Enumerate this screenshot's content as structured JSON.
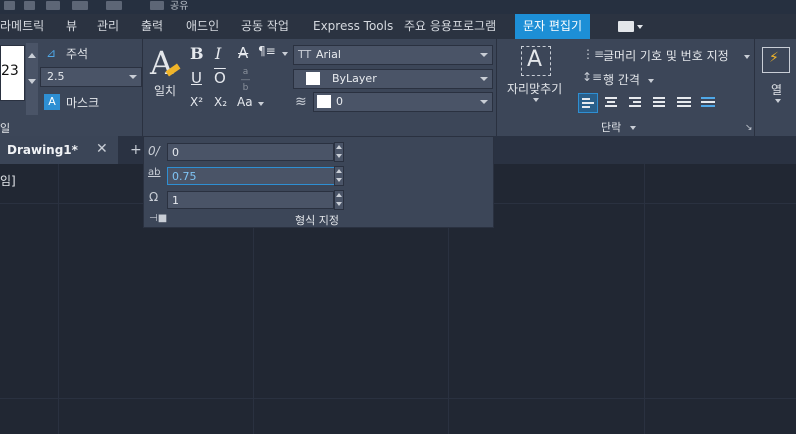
{
  "quick_access": {
    "title_fragment": "공유"
  },
  "ribbon_tabs": [
    {
      "label": "라메트릭"
    },
    {
      "label": "뷰"
    },
    {
      "label": "관리"
    },
    {
      "label": "출력"
    },
    {
      "label": "애드인"
    },
    {
      "label": "공동 작업"
    },
    {
      "label": "Express Tools"
    },
    {
      "label": "주요 응용프로그램"
    },
    {
      "label": "문자 편집기"
    }
  ],
  "active_tab_index": 8,
  "style_panel": {
    "height_value": "23",
    "annotative_label": "주석",
    "text_height": "2.5",
    "mask_label": "마스크",
    "panel_title_fragment": "일"
  },
  "format_panel": {
    "match_label": "일치",
    "bold_glyph": "B",
    "italic_glyph": "I",
    "strike_glyph": "A",
    "underline_glyph": "U",
    "overline_glyph": "O",
    "stack_glyph": "b",
    "superscript_glyph": "X²",
    "subscript_glyph": "X₂",
    "case_glyph": "Aa",
    "font": "Arial",
    "color": "ByLayer",
    "background_mask": "0"
  },
  "format_expanded": {
    "oblique_angle": "0",
    "width_factor": "0.75",
    "tracking": "1",
    "footer_label": "형식 지정"
  },
  "paragraph_panel": {
    "justify_label": "자리맞추기",
    "bullets_label": "글머리 기호 및 번호 지정",
    "line_spacing_label": "행 간격",
    "panel_title": "단락"
  },
  "insert_panel": {
    "columns_label": "열"
  },
  "document_tabs": [
    {
      "label": "Drawing1*"
    }
  ],
  "canvas": {
    "left_fragment": "임]"
  },
  "colors": {
    "active_tab": "#1d8fd6",
    "ribbon_bg": "#3c4658",
    "canvas_bg": "#212733",
    "focus_border": "#2e8fd3"
  }
}
